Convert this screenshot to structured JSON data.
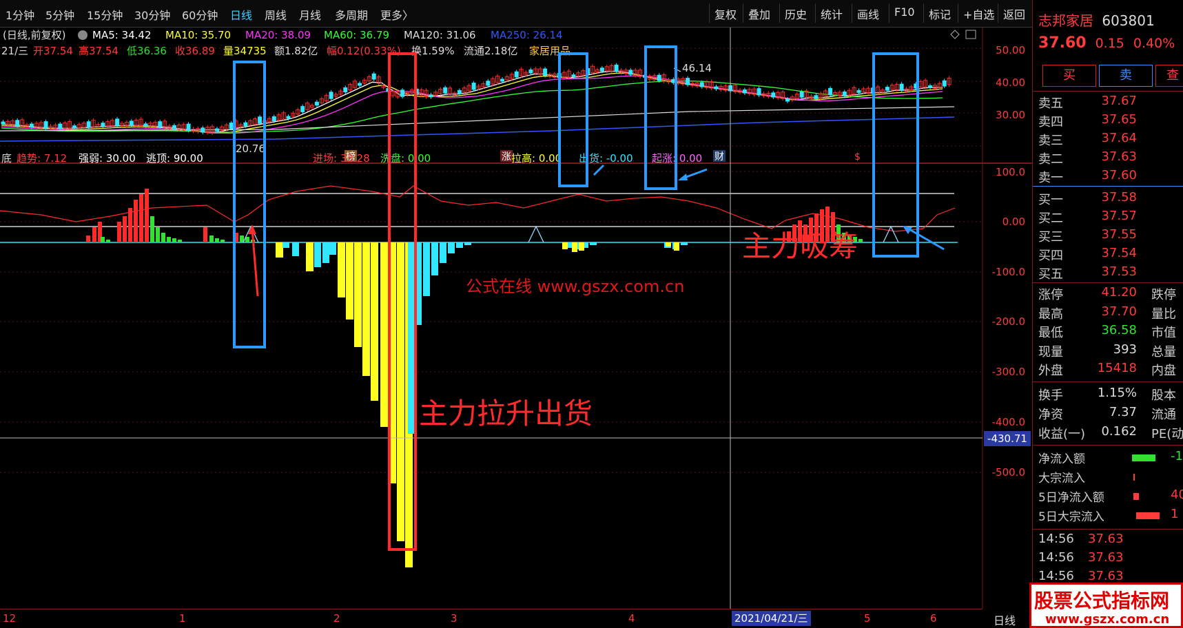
{
  "toolbar": {
    "periods": [
      "1分钟",
      "5分钟",
      "15分钟",
      "30分钟",
      "60分钟",
      "日线",
      "周线",
      "月线",
      "多周期",
      "更多〉"
    ],
    "active_period": "日线",
    "actions": [
      "复权",
      "叠加",
      "历史",
      "统计",
      "画线",
      "F10",
      "标记",
      "+自选",
      "返回"
    ]
  },
  "ma_legend": {
    "prefix": "(日线,前复权)",
    "items": [
      {
        "label": "MA5: 34.42",
        "color": "#ffffff"
      },
      {
        "label": "MA10: 35.70",
        "color": "#ffff33"
      },
      {
        "label": "MA20: 38.09",
        "color": "#ff33ff"
      },
      {
        "label": "MA60: 36.79",
        "color": "#33ff33"
      },
      {
        "label": "MA120: 31.06",
        "color": "#dddddd"
      },
      {
        "label": "MA250: 26.14",
        "color": "#3355ff"
      }
    ]
  },
  "info_line": {
    "date": "21/三",
    "open": "开37.54",
    "high": "高37.54",
    "low": "低36.36",
    "close": "收36.89",
    "volume": "量34735",
    "amount": "额1.82亿",
    "amplitude": "幅0.12(0.33%)",
    "turnover": "换1.59%",
    "float": "流通2.18亿",
    "industry": "家居用品"
  },
  "price_axis": [
    "50.00",
    "40.00",
    "30.00"
  ],
  "price_marks": {
    "high": "46.14",
    "low": "20.76"
  },
  "event_markers": [
    "榜",
    "涨",
    "财",
    "$"
  ],
  "indicator_legend": {
    "prefix": "底",
    "items": [
      {
        "label": "趋势: 7.12",
        "color": "#ff3b3b"
      },
      {
        "label": "强弱: 30.00",
        "color": "#ffffff"
      },
      {
        "label": "逃顶: 90.00",
        "color": "#ffffff"
      },
      {
        "label": "进场: 33.28",
        "color": "#ff3b3b"
      },
      {
        "label": "洗盘: 0.00",
        "color": "#33ff33"
      },
      {
        "label": "拉高: 0.00",
        "color": "#ffff33"
      },
      {
        "label": "出货: -0.00",
        "color": "#33e6ff"
      },
      {
        "label": "起涨: 0.00",
        "color": "#ff66ff"
      }
    ]
  },
  "indicator_axis": [
    "100.0",
    "0.00",
    "-100.0",
    "-200.0",
    "-300.0",
    "-400.0",
    "-500.0"
  ],
  "indicator_cursor_value": "-430.71",
  "annotations": {
    "pump_dump": "主力拉升出货",
    "accumulate": "主力吸筹",
    "site_text": "公式在线  www.gszx.com.cn"
  },
  "bottom_axis": {
    "labels": [
      "12",
      "1",
      "2",
      "3",
      "4",
      "5",
      "6"
    ],
    "cursor_date": "2021/04/21/三",
    "period": "日线"
  },
  "stock": {
    "name": "志邦家居",
    "code": "603801",
    "price": "37.60",
    "change": "0.15",
    "pct": "0.40%"
  },
  "trade_buttons": {
    "buy": "买",
    "sell": "卖",
    "check": "查"
  },
  "order_book": [
    {
      "label": "卖五",
      "value": "37.67"
    },
    {
      "label": "卖四",
      "value": "37.65"
    },
    {
      "label": "卖三",
      "value": "37.64"
    },
    {
      "label": "卖二",
      "value": "37.63"
    },
    {
      "label": "卖一",
      "value": "37.60"
    },
    {
      "label": "买一",
      "value": "37.58"
    },
    {
      "label": "买二",
      "value": "37.57"
    },
    {
      "label": "买三",
      "value": "37.55"
    },
    {
      "label": "买四",
      "value": "37.54"
    },
    {
      "label": "买五",
      "value": "37.53"
    }
  ],
  "quote_stats": [
    {
      "label": "涨停",
      "value": "41.20",
      "color": "#ff3b3b",
      "extra": "跌停"
    },
    {
      "label": "最高",
      "value": "37.70",
      "color": "#ff3b3b",
      "extra": "量比"
    },
    {
      "label": "最低",
      "value": "36.58",
      "color": "#33e033",
      "extra": "市值"
    },
    {
      "label": "现量",
      "value": "393",
      "color": "#dddddd",
      "extra": "总量"
    },
    {
      "label": "外盘",
      "value": "15418",
      "color": "#ff3b3b",
      "extra": "内盘"
    }
  ],
  "fundamentals": [
    {
      "label": "换手",
      "value": "1.15%",
      "extra": "股本"
    },
    {
      "label": "净资",
      "value": "7.37",
      "extra": "流通"
    },
    {
      "label": "收益(一)",
      "value": "0.162",
      "extra": "PE(动"
    }
  ],
  "fund_flow": [
    {
      "label": "净流入额",
      "value": "-1",
      "color": "#33e033"
    },
    {
      "label": "大宗流入",
      "value": "",
      "color": "#ff3b3b"
    },
    {
      "label": "5日净流入额",
      "value": "40",
      "color": "#ff3b3b"
    },
    {
      "label": "5日大宗流入",
      "value": "1",
      "color": "#ff3b3b"
    }
  ],
  "ticks": [
    {
      "time": "14:56",
      "price": "37.63"
    },
    {
      "time": "14:56",
      "price": "37.63"
    },
    {
      "time": "14:56",
      "price": "37.63"
    }
  ],
  "watermark": {
    "title": "股票公式指标网",
    "url": "www.gszx.com.cn"
  },
  "colors": {
    "up": "#ff2a2a",
    "down": "#33e6ff",
    "accent": "#3ad1ff",
    "box_blue": "#2b9bff",
    "box_red": "#ff2a2a"
  }
}
